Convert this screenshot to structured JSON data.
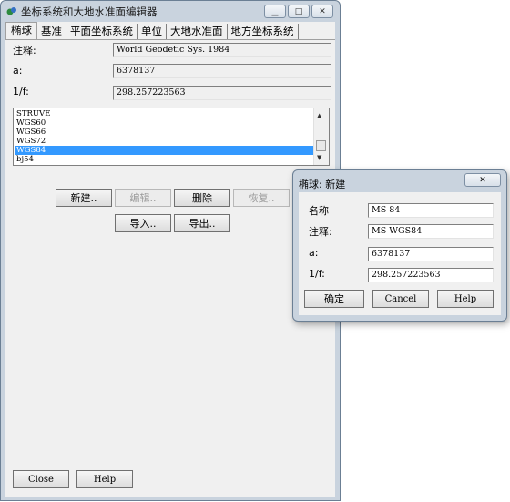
{
  "window": {
    "title": "坐标系统和大地水准面编辑器"
  },
  "tabs": [
    "椭球",
    "基准",
    "平面坐标系统",
    "单位",
    "大地水准面",
    "地方坐标系统"
  ],
  "fields": {
    "comment_label": "注释:",
    "comment_value": "World Geodetic Sys. 1984",
    "a_label": "a:",
    "a_value": "6378137",
    "f_label": "1/f:",
    "f_value": "298.257223563"
  },
  "ellipsoid_list": {
    "items": [
      "STRUVE",
      "WGS60",
      "WGS66",
      "WGS72",
      "WGS84",
      "bj54"
    ],
    "selected": "WGS84"
  },
  "buttons": {
    "new": "新建..",
    "edit": "编辑..",
    "delete": "删除",
    "restore": "恢复..",
    "import": "导入..",
    "export": "导出..",
    "close": "Close",
    "help": "Help"
  },
  "dialog": {
    "title": "椭球: 新建",
    "name_label": "名称",
    "name_value": "MS 84",
    "comment_label": "注释:",
    "comment_value": "MS WGS84",
    "a_label": "a:",
    "a_value": "6378137",
    "f_label": "1/f:",
    "f_value": "298.257223563",
    "ok": "确定",
    "cancel": "Cancel",
    "help": "Help"
  },
  "colors": {
    "selection": "#3399ff",
    "frame": "#c9d3de"
  }
}
